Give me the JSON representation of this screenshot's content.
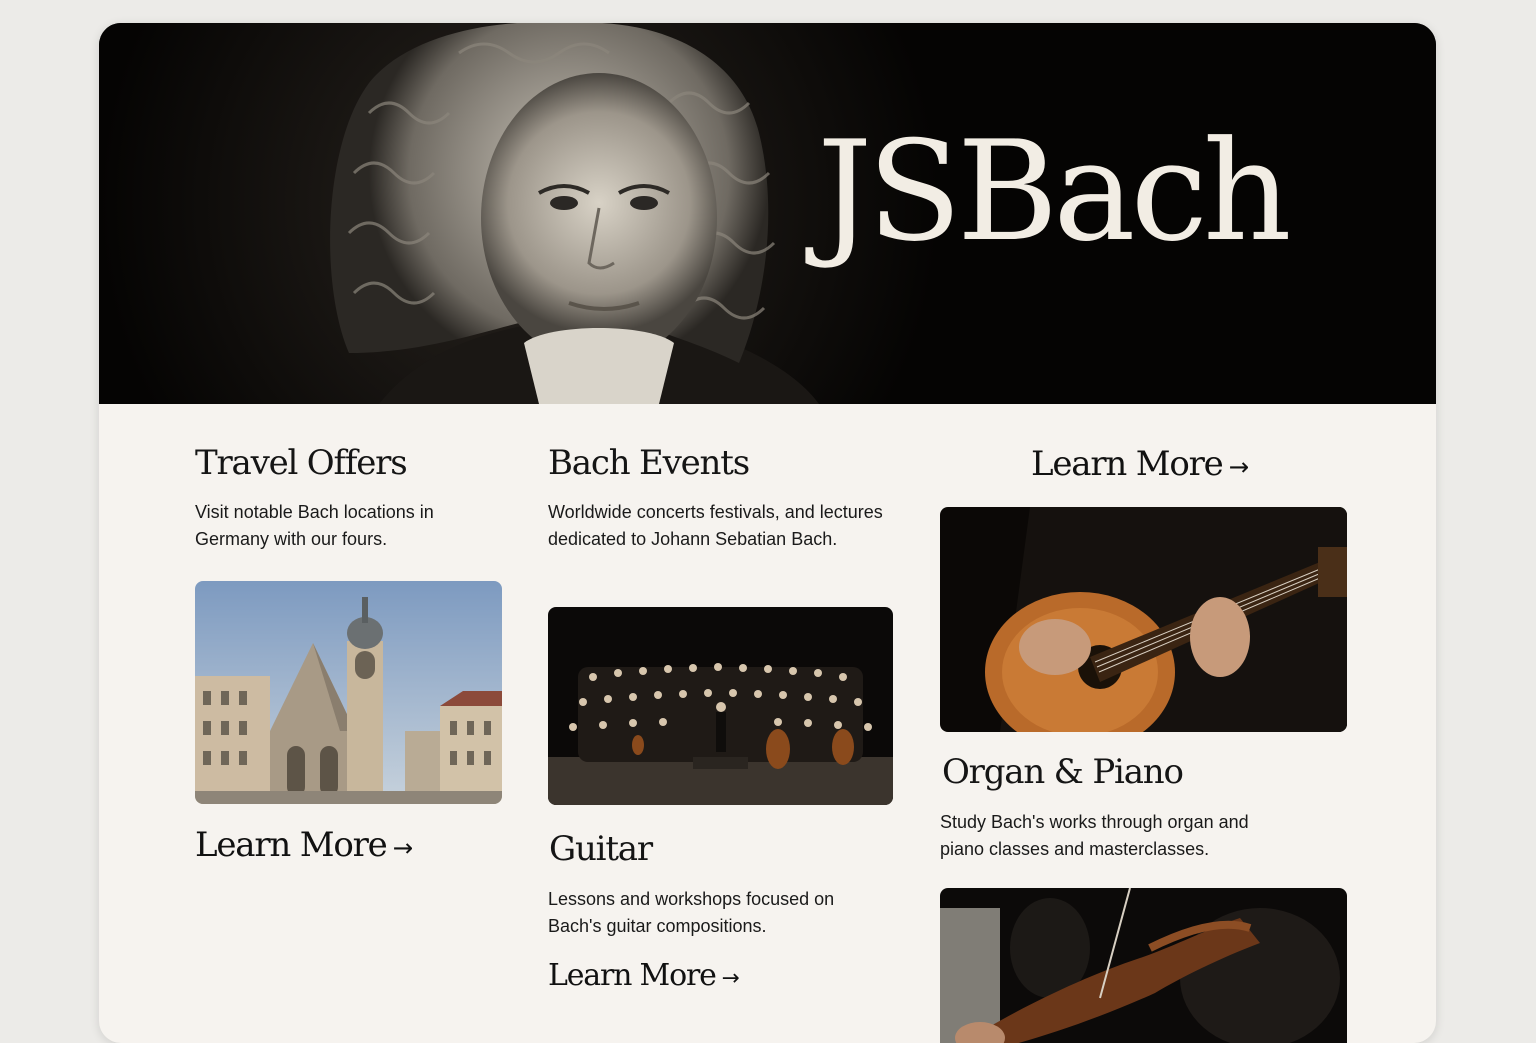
{
  "site": {
    "title": "JSBach"
  },
  "colors": {
    "page_background": "#ecebe8",
    "card_background": "#f6f3ef",
    "hero_background": "#050403",
    "title_color": "#f2ede4",
    "text_color": "#151515"
  },
  "sections": {
    "travel": {
      "title": "Travel Offers",
      "description": "Visit notable Bach locations in Germany with our fours.",
      "link": "Learn More",
      "image": "church-photo"
    },
    "events": {
      "title": "Bach Events",
      "description": "Worldwide concerts festivals, and lectures dedicated to Johann Sebatian Bach.",
      "image": "orchestra-photo"
    },
    "guitar": {
      "title": "Guitar",
      "description": "Lessons and workshops focused on Bach's guitar compositions.",
      "link": "Learn More",
      "image": "guitar-photo"
    },
    "organ_piano": {
      "title": "Organ & Piano",
      "description": "Study Bach's works through organ and piano classes and masterclasses.",
      "link_above": "Learn More",
      "image": "violin-photo"
    }
  },
  "icons": {
    "arrow": "right-arrow-icon",
    "arrow_glyph": "→"
  }
}
